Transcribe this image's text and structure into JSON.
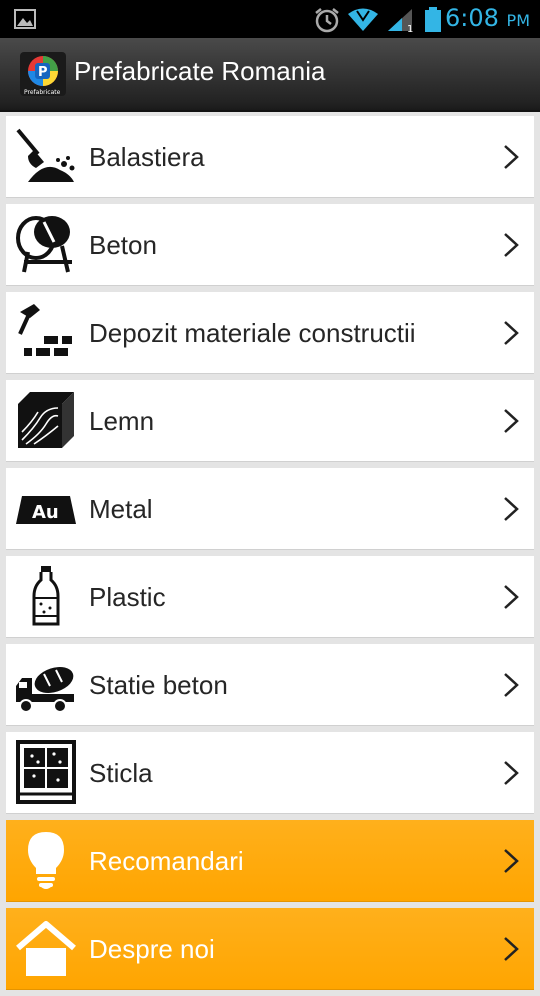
{
  "status_bar": {
    "time": "6:08",
    "ampm": "PM",
    "icons": [
      "image-icon",
      "alarm-icon",
      "wifi-icon",
      "signal-icon",
      "battery-icon"
    ]
  },
  "app": {
    "title": "Prefabricate Romania",
    "icon": "app-logo-icon",
    "icon_caption": "Prefabricate"
  },
  "menu": {
    "items": [
      {
        "label": "Balastiera",
        "icon": "shovel-icon",
        "style": "white"
      },
      {
        "label": "Beton",
        "icon": "cement-mixer-icon",
        "style": "white"
      },
      {
        "label": "Depozit materiale constructii",
        "icon": "hammer-bricks-icon",
        "style": "white"
      },
      {
        "label": "Lemn",
        "icon": "wood-icon",
        "style": "white"
      },
      {
        "label": "Metal",
        "icon": "metal-ingot-icon",
        "icon_text": "Au",
        "style": "white"
      },
      {
        "label": "Plastic",
        "icon": "plastic-bottle-icon",
        "style": "white"
      },
      {
        "label": "Statie beton",
        "icon": "concrete-truck-icon",
        "style": "white"
      },
      {
        "label": "Sticla",
        "icon": "glass-window-icon",
        "style": "white"
      },
      {
        "label": "Recomandari",
        "icon": "lightbulb-icon",
        "style": "orange"
      },
      {
        "label": "Despre noi",
        "icon": "home-icon",
        "style": "orange"
      }
    ]
  },
  "colors": {
    "accent_orange": "#ffa500",
    "status_blue": "#33b5e5",
    "item_text": "#262626"
  }
}
